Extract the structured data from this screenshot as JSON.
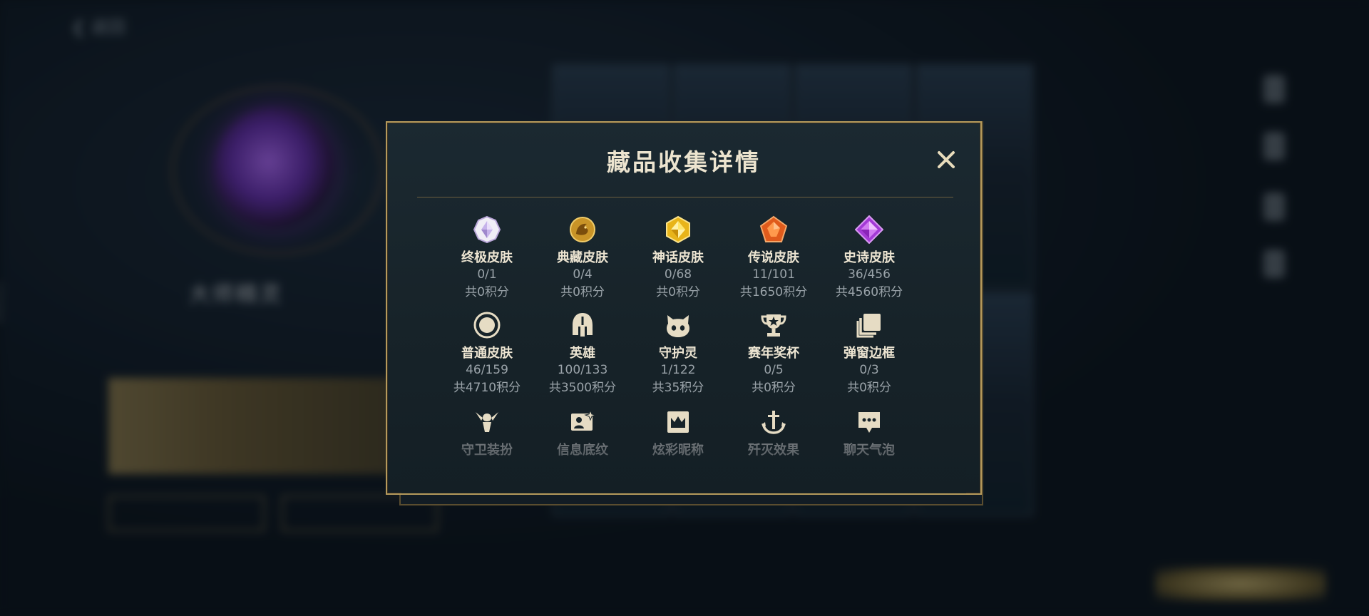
{
  "background": {
    "back_label": "返回",
    "player_name": "大师精灵",
    "player_sub": "",
    "side_id": "3792844",
    "banner_text": "",
    "buttons": [
      "",
      ""
    ],
    "bottom_tabs": [
      "",
      "",
      "",
      ""
    ],
    "bottom_active": ""
  },
  "modal": {
    "title": "藏品收集详情",
    "close_icon": "close-icon",
    "accent_color": "#b59a5c",
    "categories": [
      {
        "icon": "ultimate-skin-icon",
        "name": "终极皮肤",
        "count": "0/1",
        "points": "共0积分"
      },
      {
        "icon": "prestige-skin-icon",
        "name": "典藏皮肤",
        "count": "0/4",
        "points": "共0积分"
      },
      {
        "icon": "mythic-skin-icon",
        "name": "神话皮肤",
        "count": "0/68",
        "points": "共0积分"
      },
      {
        "icon": "legendary-skin-icon",
        "name": "传说皮肤",
        "count": "11/101",
        "points": "共1650积分"
      },
      {
        "icon": "epic-skin-icon",
        "name": "史诗皮肤",
        "count": "36/456",
        "points": "共4560积分"
      },
      {
        "icon": "normal-skin-icon",
        "name": "普通皮肤",
        "count": "46/159",
        "points": "共4710积分"
      },
      {
        "icon": "champion-helmet-icon",
        "name": "英雄",
        "count": "100/133",
        "points": "共3500积分"
      },
      {
        "icon": "guardian-spirit-icon",
        "name": "守护灵",
        "count": "1/122",
        "points": "共35积分"
      },
      {
        "icon": "trophy-icon",
        "name": "赛年奖杯",
        "count": "0/5",
        "points": "共0积分"
      },
      {
        "icon": "popup-frame-icon",
        "name": "弹窗边框",
        "count": "0/3",
        "points": "共0积分"
      },
      {
        "icon": "guardian-outfit-icon",
        "name": "守卫装扮"
      },
      {
        "icon": "profile-texture-icon",
        "name": "信息底纹"
      },
      {
        "icon": "nickname-crown-icon",
        "name": "炫彩昵称"
      },
      {
        "icon": "anchor-effect-icon",
        "name": "歼灭效果"
      },
      {
        "icon": "chat-bubble-icon",
        "name": "聊天气泡"
      }
    ]
  }
}
